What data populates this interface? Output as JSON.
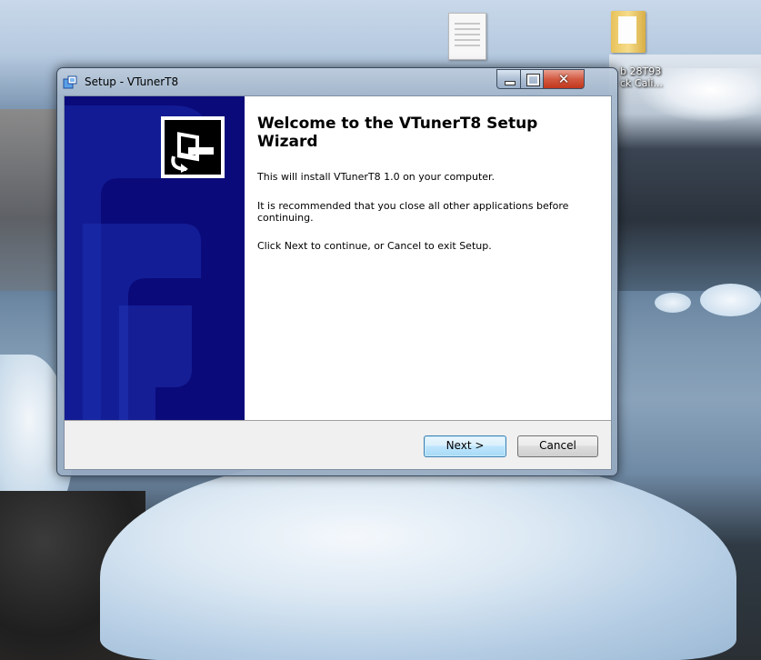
{
  "desktop": {
    "icons": [
      {
        "name": "text-document",
        "label": ""
      },
      {
        "name": "folder",
        "label": "b 28T93\nck Cali..."
      }
    ]
  },
  "window": {
    "title": "Setup - VTunerT8",
    "buttons": {
      "minimize": "minimize",
      "maximize": "maximize",
      "close": "close"
    },
    "close_glyph": "✕"
  },
  "wizard": {
    "heading": "Welcome to the VTunerT8 Setup Wizard",
    "paragraphs": [
      "This will install VTunerT8 1.0 on your computer.",
      "It is recommended that you close all other applications before continuing.",
      "Click Next to continue, or Cancel to exit Setup."
    ],
    "next_label": "Next >",
    "cancel_label": "Cancel"
  },
  "colors": {
    "banner": "#0a0a7a",
    "next_border": "#3c7fb1",
    "close_button": "#c0361c"
  }
}
